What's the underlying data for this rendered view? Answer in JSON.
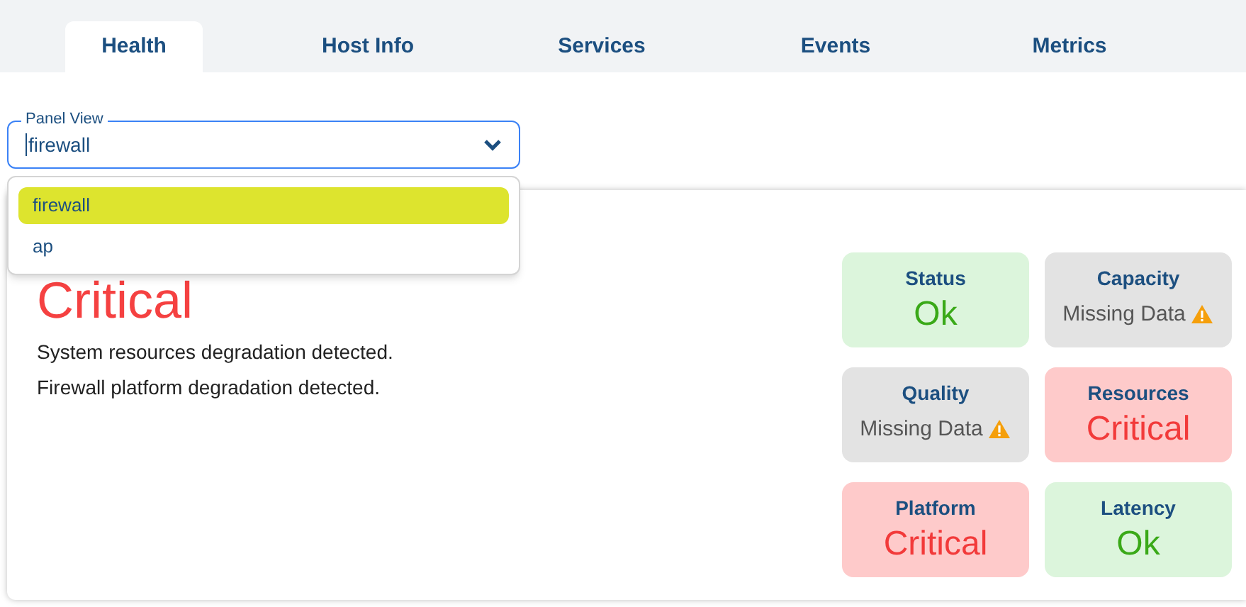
{
  "tabs": [
    {
      "label": "Health",
      "selected": true
    },
    {
      "label": "Host Info",
      "selected": false
    },
    {
      "label": "Services",
      "selected": false
    },
    {
      "label": "Events",
      "selected": false
    },
    {
      "label": "Metrics",
      "selected": false
    }
  ],
  "panel_view": {
    "label": "Panel View",
    "value": "firewall",
    "expanded": true,
    "options": [
      {
        "label": "firewall",
        "selected": true
      },
      {
        "label": "ap",
        "selected": false
      }
    ]
  },
  "health": {
    "overall": "Critical",
    "kind": "critical",
    "messages": [
      "System resources degradation detected.",
      "Firewall platform degradation detected."
    ],
    "tiles": [
      {
        "title": "Status",
        "kind": "ok",
        "value": "Ok"
      },
      {
        "title": "Capacity",
        "kind": "missing",
        "value": "Missing Data"
      },
      {
        "title": "Quality",
        "kind": "missing",
        "value": "Missing Data"
      },
      {
        "title": "Resources",
        "kind": "critical",
        "value": "Critical"
      },
      {
        "title": "Platform",
        "kind": "critical",
        "value": "Critical"
      },
      {
        "title": "Latency",
        "kind": "ok",
        "value": "Ok"
      }
    ]
  }
}
